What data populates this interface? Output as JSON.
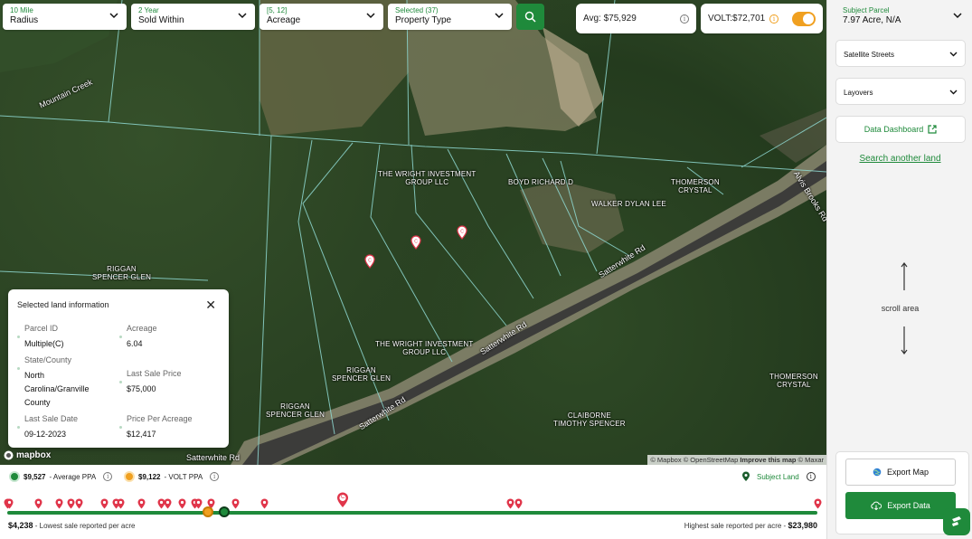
{
  "filters": {
    "radius": {
      "label": "10 Mile",
      "value": "Radius"
    },
    "time": {
      "label": "2 Year",
      "value": "Sold Within"
    },
    "acreage": {
      "label": "[5, 12]",
      "value": "Acreage"
    },
    "property_type": {
      "label": "Selected (37)",
      "value": "Property Type"
    }
  },
  "stats": {
    "avg": "Avg: $75,929",
    "volt": "VOLT:$72,701",
    "volt_toggle_on": true
  },
  "map": {
    "labels": {
      "mountain_creek": "Mountain Creek",
      "wright_top": "THE WRIGHT INVESTMENT\nGROUP LLC",
      "boyd": "BOYD RICHARD D",
      "walker": "WALKER DYLAN LEE",
      "thomerson_top": "THOMERSON\nCRYSTAL",
      "riggan_left": "RIGGAN\nSPENCER GLEN",
      "wright_bottom": "THE WRIGHT INVESTMENT\nGROUP LLC",
      "riggan_mid": "RIGGAN\nSPENCER GLEN",
      "riggan_bottom": "RIGGAN\nSPENCER GLEN",
      "claiborne": "CLAIBORNE\nTIMOTHY SPENCER",
      "thomerson_bottom": "THOMERSON\nCRYSTAL",
      "satterwhite_1": "Satterwhite Rd",
      "satterwhite_2": "Satterwhite Rd",
      "satterwhite_3": "Satterwhite Rd",
      "satterwhite_4": "Satterwhite Rd",
      "alvis": "Alvis Brooks Rd"
    },
    "pin_letter": "C",
    "logo": "mapbox",
    "attribution": "© Mapbox © OpenStreetMap",
    "improve": "Improve this map",
    "maxar": "© Maxar"
  },
  "info_card": {
    "title": "Selected land information",
    "parcel_id_label": "Parcel ID",
    "parcel_id": "Multiple(C)",
    "acreage_label": "Acreage",
    "acreage": "6.04",
    "state_label": "State/County",
    "state": "North\nCarolina/Granville\nCounty",
    "last_price_label": "Last Sale Price",
    "last_price": "$75,000",
    "last_date_label": "Last Sale Date",
    "last_date": "09-12-2023",
    "ppa_label": "Price Per Acreage",
    "ppa": "$12,417"
  },
  "bottom": {
    "avg_ppa_value": "$9,527",
    "avg_ppa_label": "- Average PPA",
    "volt_ppa_value": "$9,122",
    "volt_ppa_label": "- VOLT PPA",
    "subject_land": "Subject Land",
    "lowest_value": "$4,238",
    "lowest_label": "- Lowest sale reported per acre",
    "highest_label": "Highest sale reported per acre -",
    "highest_value": "$23,980",
    "subject_marker": "C",
    "range": {
      "min": 4238,
      "max": 23980,
      "avg": 9527,
      "volt": 9122,
      "subject": 12417
    },
    "comps_ppa": [
      4238,
      4300,
      5000,
      5500,
      5800,
      6000,
      6600,
      6900,
      7000,
      7500,
      8000,
      8150,
      8500,
      8800,
      8900,
      9200,
      9800,
      10500,
      16500,
      16700,
      23980
    ]
  },
  "colors": {
    "accent": "#1f8a3b",
    "volt": "#f0a020",
    "pin": "#e0354a"
  },
  "sidebar": {
    "subject_parcel_label": "Subject Parcel",
    "subject_parcel_value": "7.97 Acre, N/A",
    "map_style": "Satellite Streets",
    "layovers": "Layovers",
    "data_dashboard": "Data Dashboard",
    "search_another": "Search another land",
    "scroll_area": "scroll area",
    "export_map": "Export Map",
    "export_data": "Export Data"
  }
}
